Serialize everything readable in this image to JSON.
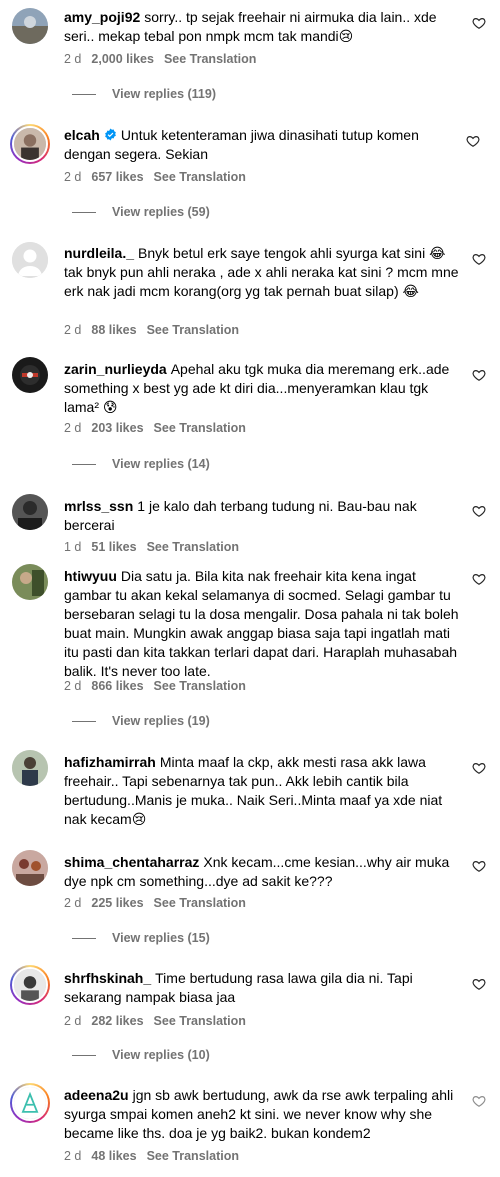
{
  "comments": [
    {
      "username": "amy_poji92",
      "text": "sorry.. tp sejak freehair ni airmuka dia lain.. xde seri.. mekap tebal pon nmpk mcm tak mandi",
      "emoji": "😢",
      "time": "2 d",
      "likes": "2,000 likes",
      "translate": "See Translation",
      "replies": "View replies (119)"
    },
    {
      "username": "elcah",
      "verified": true,
      "text": "Untuk ketenteraman jiwa dinasihati tutup komen dengan segera. Sekian",
      "time": "2 d",
      "likes": "657 likes",
      "translate": "See Translation",
      "replies": "View replies (59)"
    },
    {
      "username": "nurdleila._",
      "text": "Bnyk betul erk saye tengok ahli syurga kat sini 😂 tak bnyk pun ahli neraka , ade x ahli neraka kat sini ? mcm mne erk nak jadi mcm korang(org yg tak pernah buat silap) 😂",
      "time": "2 d",
      "likes": "88 likes",
      "translate": "See Translation"
    },
    {
      "username": "zarin_nurlieyda",
      "text": "Apehal aku tgk muka dia meremang erk..ade something x best yg ade kt diri dia...menyeramkan klau tgk lama² 😰",
      "time": "2 d",
      "likes": "203 likes",
      "translate": "See Translation",
      "replies": "View replies (14)"
    },
    {
      "username": "mrlss_ssn",
      "text": "1 je kalo dah terbang tudung ni. Bau-bau nak bercerai",
      "time": "1 d",
      "likes": "51 likes",
      "translate": "See Translation"
    },
    {
      "username": "htiwyuu",
      "text": "Dia satu ja. Bila kita nak freehair kita kena ingat gambar tu akan kekal selamanya di socmed. Selagi gambar tu bersebaran selagi tu la dosa mengalir. Dosa pahala ni tak boleh buat main. Mungkin awak anggap biasa saja tapi ingatlah mati itu pasti dan kita takkan terlari dapat dari. Haraplah muhasabah balik. It's never too late.",
      "time": "2 d",
      "likes": "866 likes",
      "translate": "See Translation",
      "replies": "View replies (19)"
    },
    {
      "username": "hafizhamirrah",
      "text": "Minta maaf la ckp, akk mesti rasa akk lawa freehair.. Tapi sebenarnya tak pun.. Akk lebih cantik bila bertudung..Manis je muka.. Naik Seri..Minta maaf ya xde niat nak kecam",
      "emoji": "😢"
    },
    {
      "username": "shima_chentaharraz",
      "text": "Xnk kecam...cme kesian...why air muka dye npk cm something...dye ad sakit ke???",
      "time": "2 d",
      "likes": "225 likes",
      "translate": "See Translation",
      "replies": "View replies (15)"
    },
    {
      "username": "shrfhskinah_",
      "text": "Time bertudung rasa lawa gila dia ni. Tapi sekarang nampak biasa jaa",
      "time": "2 d",
      "likes": "282 likes",
      "translate": "See Translation",
      "replies": "View replies (10)"
    },
    {
      "username": "adeena2u",
      "text": "jgn sb awk bertudung, awk da rse awk terpaling ahli syurga smpai komen aneh2 kt sini. we never know why she became like ths. doa je yg baik2. bukan kondem2",
      "time": "2 d",
      "likes": "48 likes",
      "translate": "See Translation"
    }
  ],
  "colors": {
    "secondary_text": "#737373",
    "verified_blue": "#0095f6"
  },
  "icons": {
    "like": "heart-outline-icon",
    "verified": "verified-badge-icon"
  }
}
